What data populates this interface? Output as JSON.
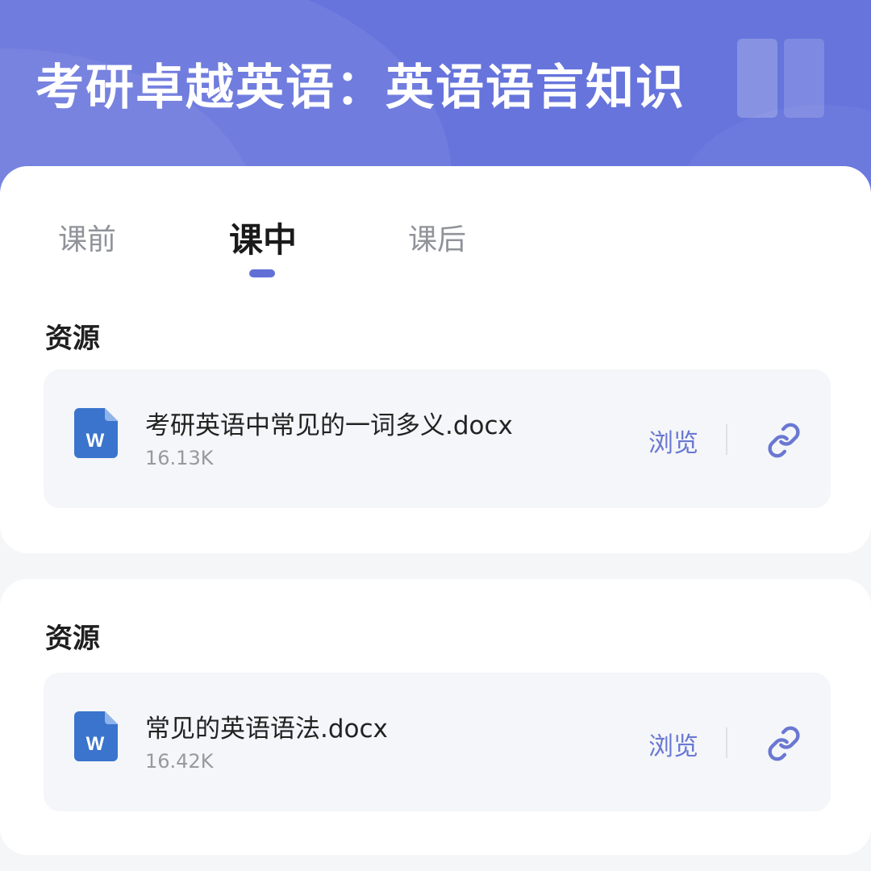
{
  "header": {
    "title": "考研卓越英语：英语语言知识",
    "accent_color": "#6674dc",
    "decor_icon": "book-icon"
  },
  "tabs": [
    {
      "label": "课前",
      "active": false
    },
    {
      "label": "课中",
      "active": true
    },
    {
      "label": "课后",
      "active": false
    }
  ],
  "sections": [
    {
      "title": "资源",
      "files": [
        {
          "name": "考研英语中常见的一词多义.docx",
          "size": "16.13K",
          "icon": "word-doc-icon",
          "view_label": "浏览",
          "link_icon": "link-icon"
        }
      ]
    },
    {
      "title": "资源",
      "files": [
        {
          "name": "常见的英语语法.docx",
          "size": "16.42K",
          "icon": "word-doc-icon",
          "view_label": "浏览",
          "link_icon": "link-icon"
        }
      ]
    }
  ],
  "colors": {
    "link_text": "#6a78d2",
    "word_icon": "#3a74cc"
  }
}
